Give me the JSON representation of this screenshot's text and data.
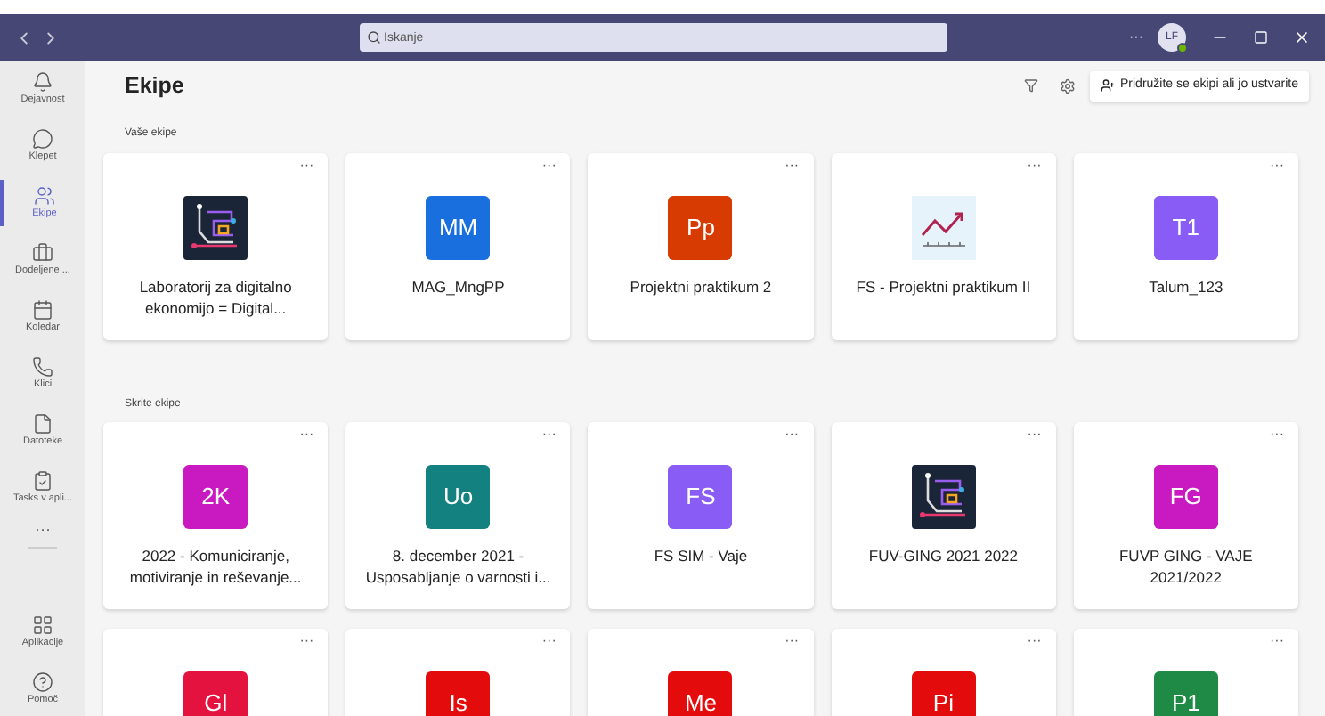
{
  "titlebar": {
    "search": {
      "placeholder": "Iskanje"
    },
    "more": "···",
    "avatar": "LF",
    "online": true
  },
  "sidebar": {
    "items": [
      {
        "label": "Dejavnost",
        "kind": "bell",
        "selected": false
      },
      {
        "label": "Klepet",
        "kind": "chat",
        "selected": false
      },
      {
        "label": "Ekipe",
        "kind": "teams",
        "selected": true
      },
      {
        "label": "Dodeljene ...",
        "kind": "bag",
        "selected": false
      },
      {
        "label": "Koledar",
        "kind": "calendar",
        "selected": false
      },
      {
        "label": "Klici",
        "kind": "phone",
        "selected": false
      },
      {
        "label": "Datoteke",
        "kind": "file",
        "selected": false
      },
      {
        "label": "Tasks v apli...",
        "kind": "tasks",
        "selected": false
      }
    ],
    "more": "···",
    "bottom": [
      {
        "label": "Aplikacije",
        "kind": "apps",
        "selected": false
      },
      {
        "label": "Pomoč",
        "kind": "help",
        "selected": false
      }
    ]
  },
  "header": {
    "title": "Ekipe",
    "join_button": "Pridružite se ekipi ali jo ustvarite"
  },
  "sections": [
    {
      "title": "Vaše ekipe",
      "teams": [
        {
          "name": "Laboratorij za digitalno ekonomijo = Digital...",
          "kind": "logo"
        },
        {
          "name": "MAG_MngPP",
          "kind": "initials",
          "initials": "MM",
          "color": "#1a6fde"
        },
        {
          "name": "Projektni praktikum 2",
          "kind": "initials",
          "initials": "Pp",
          "color": "#d83b01"
        },
        {
          "name": "FS - Projektni praktikum II",
          "kind": "chart"
        },
        {
          "name": "Talum_123",
          "kind": "initials",
          "initials": "T1",
          "color": "#8a5cf6"
        }
      ]
    },
    {
      "title": "Skrite ekipe",
      "teams": [
        {
          "name": "2022 - Komuniciranje, motiviranje in reševanje...",
          "kind": "initials",
          "initials": "2K",
          "color": "#c919c1"
        },
        {
          "name": "8. december 2021 - Usposabljanje o varnosti i...",
          "kind": "initials",
          "initials": "Uo",
          "color": "#138180"
        },
        {
          "name": "FS SIM - Vaje",
          "kind": "initials",
          "initials": "FS",
          "color": "#8a5cf6"
        },
        {
          "name": "FUV-GING 2021 2022",
          "kind": "logo"
        },
        {
          "name": "FUVP GING - VAJE 2021/2022",
          "kind": "initials",
          "initials": "FG",
          "color": "#c919c1"
        },
        {
          "kind": "initials",
          "initials": "Gl",
          "color": "#e3123e"
        },
        {
          "kind": "initials",
          "initials": "Is",
          "color": "#e30b0b"
        },
        {
          "kind": "initials",
          "initials": "Me",
          "color": "#e30b0b"
        },
        {
          "kind": "initials",
          "initials": "Pi",
          "color": "#e30b0b"
        },
        {
          "kind": "initials",
          "initials": "P1",
          "color": "#1e8a45"
        }
      ]
    }
  ]
}
